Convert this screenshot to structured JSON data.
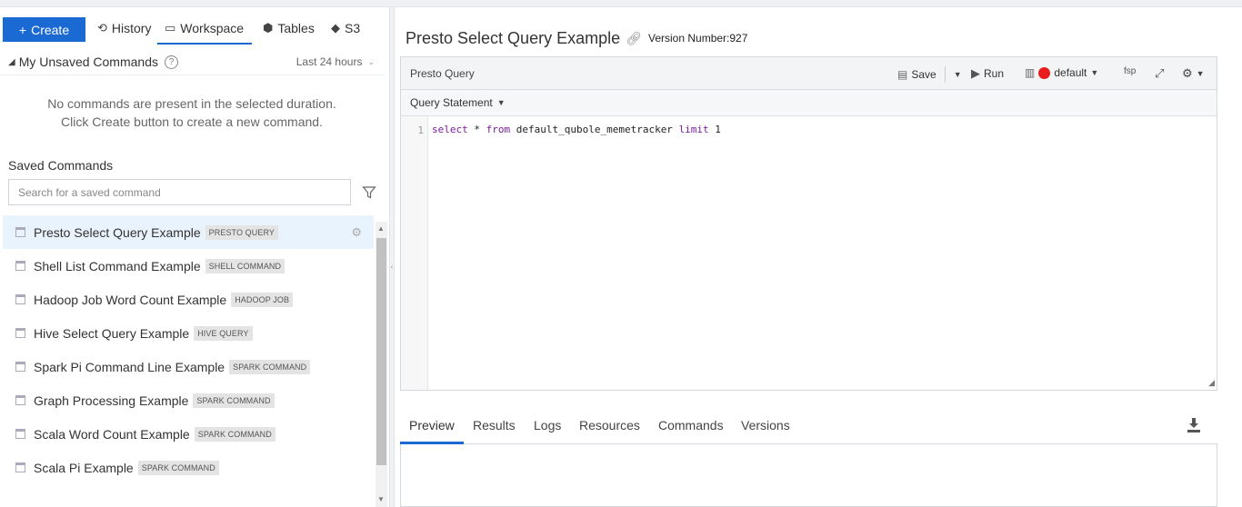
{
  "colors": {
    "accent": "#1b6ad4",
    "cluster_status": "#e81c1c"
  },
  "nav": {
    "create_label": "Create",
    "tabs": [
      {
        "label": "History",
        "icon": "history-icon"
      },
      {
        "label": "Workspace",
        "icon": "workspace-icon"
      },
      {
        "label": "Tables",
        "icon": "tables-icon"
      },
      {
        "label": "S3",
        "icon": "s3-icon"
      }
    ],
    "active_tab": "Workspace"
  },
  "unsaved": {
    "title": "My Unsaved Commands",
    "duration": "Last 24 hours",
    "empty_line1": "No commands are present in the selected duration.",
    "empty_line2": "Click Create button to create a new command."
  },
  "saved": {
    "title": "Saved Commands",
    "search_placeholder": "Search for a saved command",
    "items": [
      {
        "name": "Presto Select Query Example",
        "tag": "PRESTO QUERY"
      },
      {
        "name": "Shell List Command Example",
        "tag": "SHELL COMMAND"
      },
      {
        "name": "Hadoop Job Word Count Example",
        "tag": "HADOOP JOB"
      },
      {
        "name": "Hive Select Query Example",
        "tag": "HIVE QUERY"
      },
      {
        "name": "Spark Pi Command Line Example",
        "tag": "SPARK COMMAND"
      },
      {
        "name": "Graph Processing Example",
        "tag": "SPARK COMMAND"
      },
      {
        "name": "Scala Word Count Example",
        "tag": "SPARK COMMAND"
      },
      {
        "name": "Scala Pi Example",
        "tag": "SPARK COMMAND"
      }
    ]
  },
  "query": {
    "title": "Presto Select Query Example",
    "version": "Version Number:927",
    "type_label": "Presto Query",
    "save_label": "Save",
    "run_label": "Run",
    "cluster": "default",
    "fsp_label": "fsp",
    "statement_label": "Query Statement",
    "line_number": "1",
    "code": {
      "kw1": "select",
      "mid1": " * ",
      "kw2": "from",
      "mid2": " default_qubole_memetracker ",
      "kw3": "limit",
      "mid3": " 1"
    }
  },
  "results": {
    "tabs": [
      "Preview",
      "Results",
      "Logs",
      "Resources",
      "Commands",
      "Versions"
    ],
    "active": "Preview"
  }
}
